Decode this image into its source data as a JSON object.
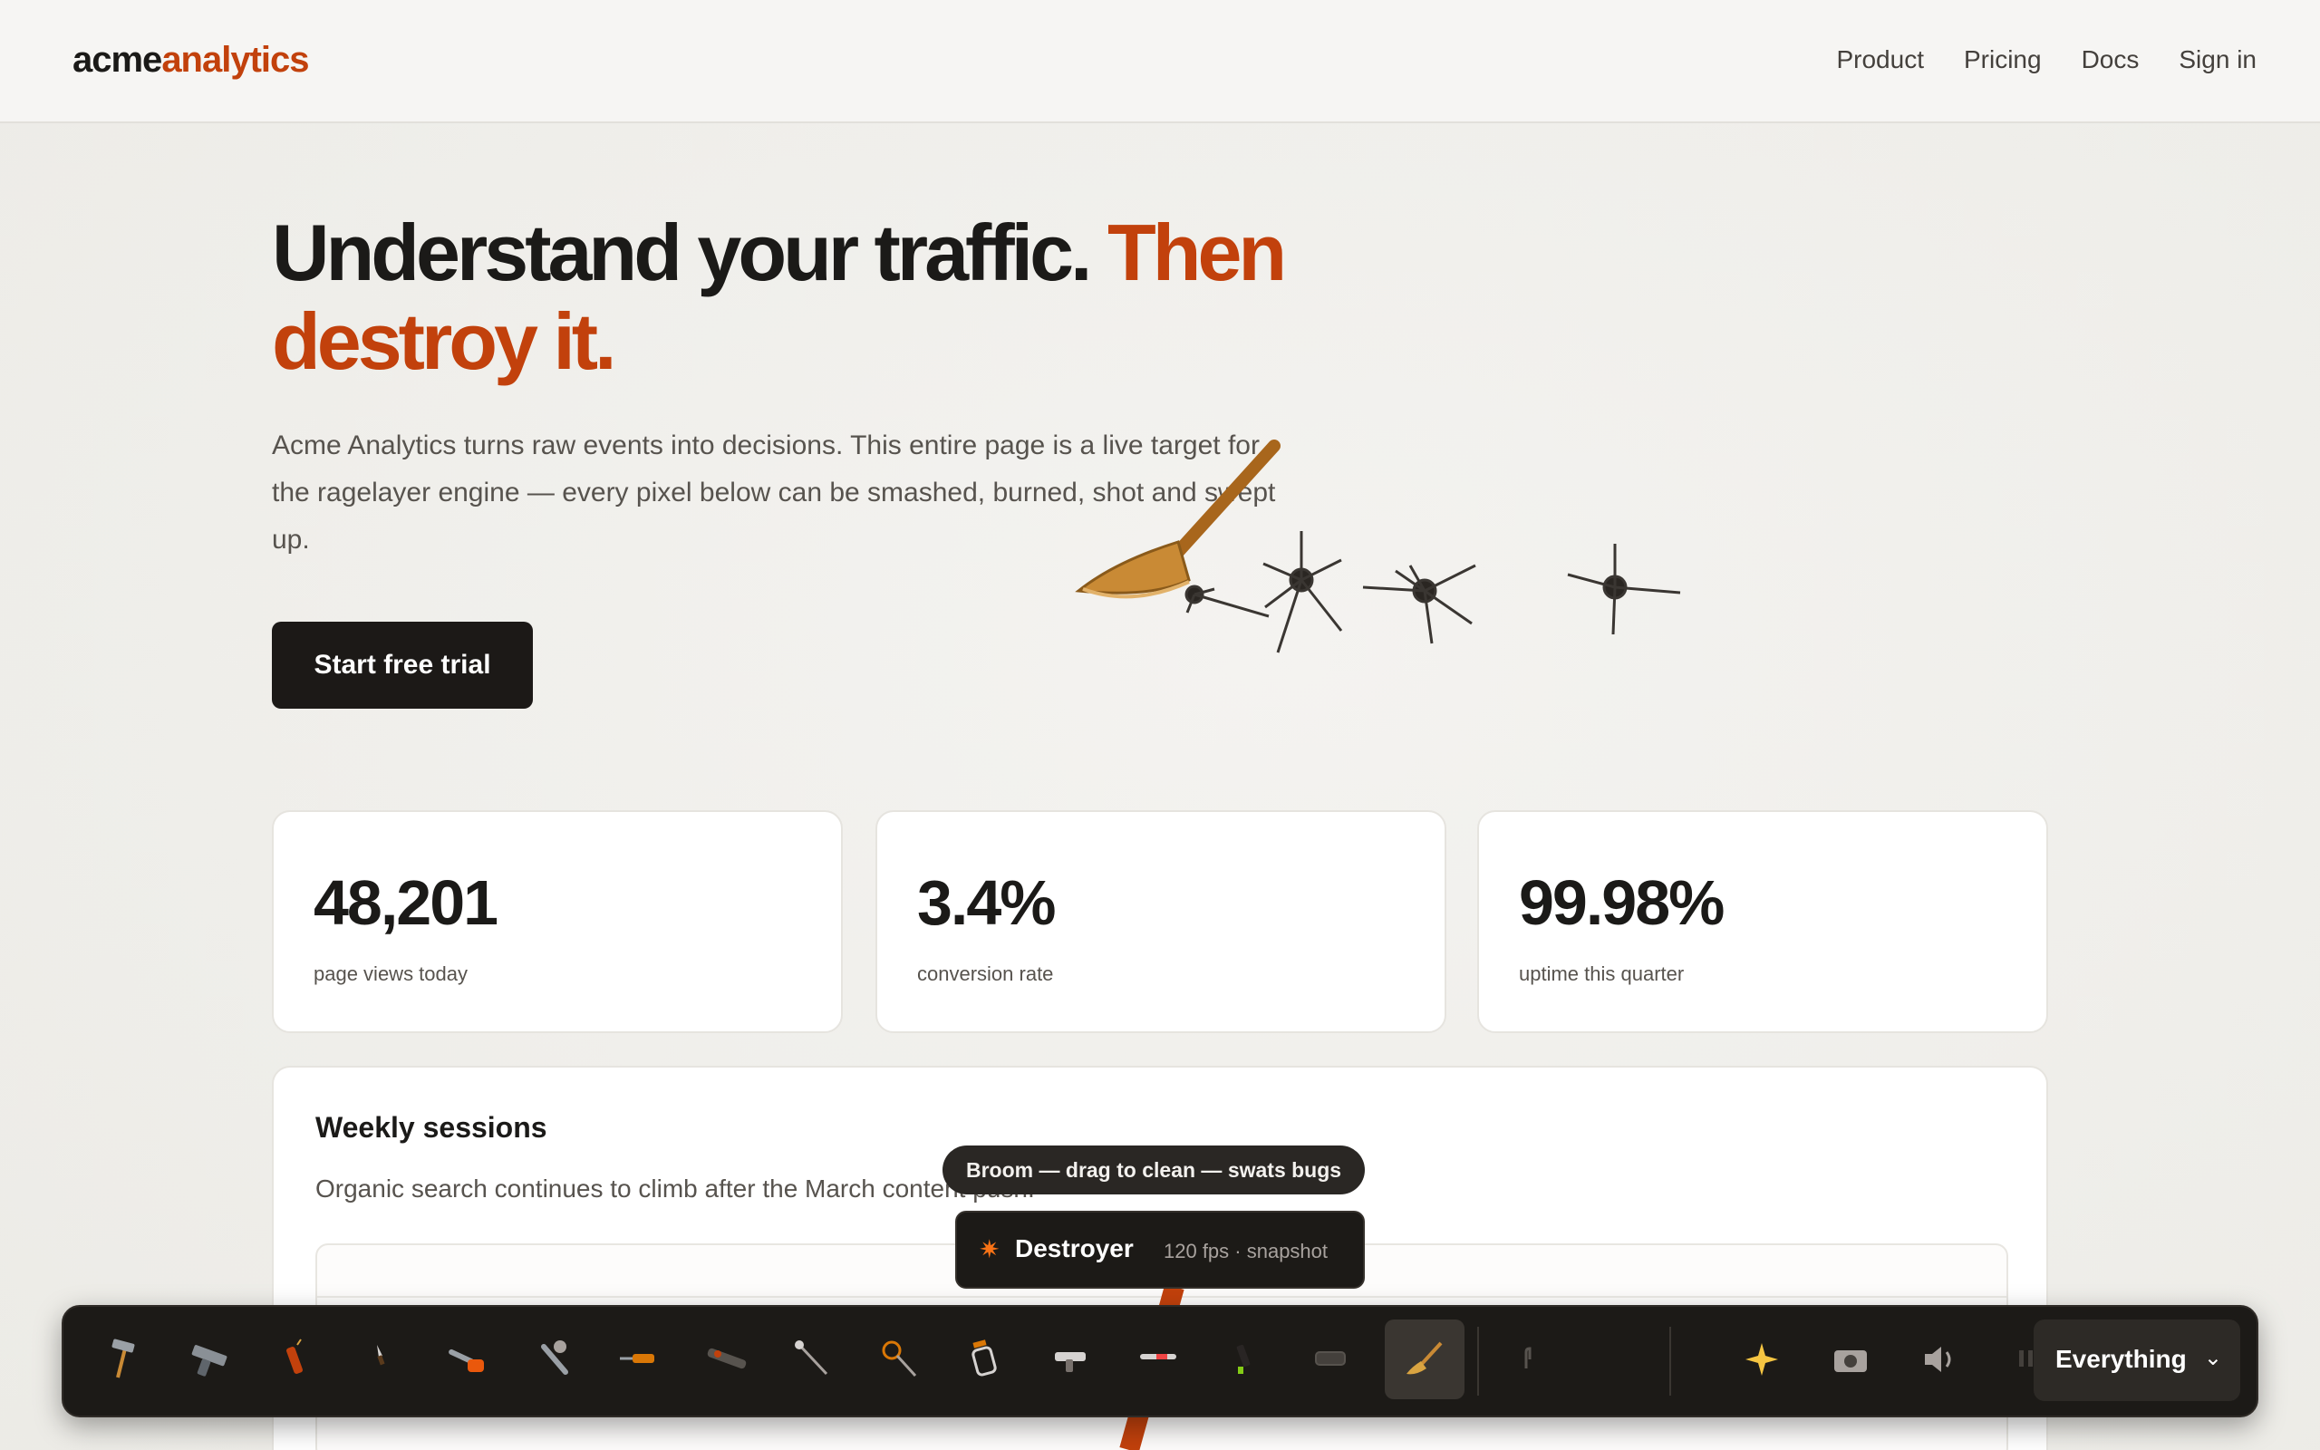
{
  "brand": {
    "part1": "acme",
    "part2": "analytics",
    "accent_color": "#c2410c"
  },
  "nav": {
    "items": [
      {
        "label": "Product"
      },
      {
        "label": "Pricing"
      },
      {
        "label": "Docs"
      },
      {
        "label": "Sign in"
      }
    ]
  },
  "hero": {
    "title_main": "Understand your traffic. ",
    "title_accent": "Then destroy it.",
    "subtitle": "Acme Analytics turns raw events into decisions. This entire page is a live target for the ragelayer engine — every pixel below can be smashed, burned, shot and swept up.",
    "cta": "Start free trial"
  },
  "stats": [
    {
      "value": "48,201",
      "label": "page views today"
    },
    {
      "value": "3.4%",
      "label": "conversion rate"
    },
    {
      "value": "99.98%",
      "label": "uptime this quarter"
    }
  ],
  "chart_card": {
    "title": "Weekly sessions",
    "subtitle": "Organic search continues to climb after the March content push."
  },
  "tooltip": "Broom — drag to clean — swats bugs",
  "destroyer": {
    "icon": "burst-icon",
    "name": "Destroyer",
    "meta": "120 fps · snapshot"
  },
  "toolbar": {
    "tools": [
      "hammer-icon",
      "gun-icon",
      "dynamite-icon",
      "knife-icon",
      "chainsaw-icon",
      "wrench-icon",
      "drill-icon",
      "rocket-launcher-icon",
      "wand-icon",
      "hypnosis-icon",
      "jar-icon",
      "blaster-icon",
      "laser-icon",
      "marker-icon",
      "eraser-icon",
      "broom-icon",
      "hand-icon"
    ],
    "active_tool": "broom-icon",
    "extras": [
      "sparkles-icon",
      "camera-icon",
      "speaker-icon",
      "pause-icon"
    ],
    "mode": "Everything"
  }
}
